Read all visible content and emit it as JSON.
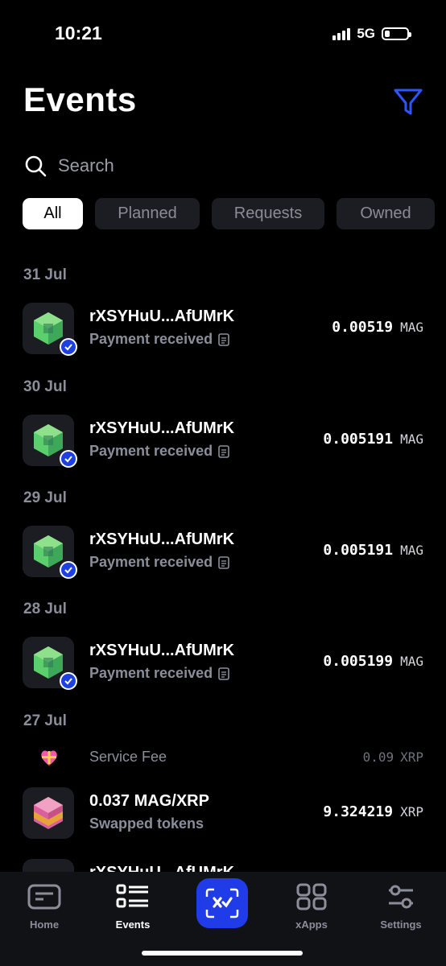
{
  "status_bar": {
    "time": "10:21",
    "network": "5G"
  },
  "page": {
    "title": "Events"
  },
  "search": {
    "placeholder": "Search"
  },
  "tabs": [
    {
      "label": "All",
      "active": true
    },
    {
      "label": "Planned",
      "active": false
    },
    {
      "label": "Requests",
      "active": false
    },
    {
      "label": "Owned",
      "active": false
    }
  ],
  "groups": [
    {
      "date": "31 Jul",
      "items": [
        {
          "title": "rXSYHuU...AfUMrK",
          "subtitle": "Payment received",
          "amount": "0.00519",
          "currency": "MAG"
        }
      ]
    },
    {
      "date": "30 Jul",
      "items": [
        {
          "title": "rXSYHuU...AfUMrK",
          "subtitle": "Payment received",
          "amount": "0.005191",
          "currency": "MAG"
        }
      ]
    },
    {
      "date": "29 Jul",
      "items": [
        {
          "title": "rXSYHuU...AfUMrK",
          "subtitle": "Payment received",
          "amount": "0.005191",
          "currency": "MAG"
        }
      ]
    },
    {
      "date": "28 Jul",
      "items": [
        {
          "title": "rXSYHuU...AfUMrK",
          "subtitle": "Payment received",
          "amount": "0.005199",
          "currency": "MAG"
        }
      ]
    },
    {
      "date": "27 Jul",
      "fee": {
        "label": "Service Fee",
        "amount": "0.09",
        "currency": "XRP",
        "icon": "heart-gift-icon"
      },
      "items": [
        {
          "title": "0.037 MAG/XRP",
          "subtitle": "Swapped tokens",
          "amount": "9.324219",
          "currency": "XRP"
        },
        {
          "title": "rXSYHuU...AfUMrK"
        }
      ]
    }
  ],
  "tab_bar": [
    {
      "label": "Home",
      "icon": "wallet-icon"
    },
    {
      "label": "Events",
      "icon": "list-icon",
      "active": true
    },
    {
      "label": "",
      "icon": "xumm-scan-icon"
    },
    {
      "label": "xApps",
      "icon": "grid-icon"
    },
    {
      "label": "Settings",
      "icon": "sliders-icon"
    }
  ],
  "colors": {
    "accent": "#1f3ce8",
    "muted": "#8b8d9a",
    "tab_bg": "#1c1d23",
    "token_green": "#5ccf6d"
  }
}
